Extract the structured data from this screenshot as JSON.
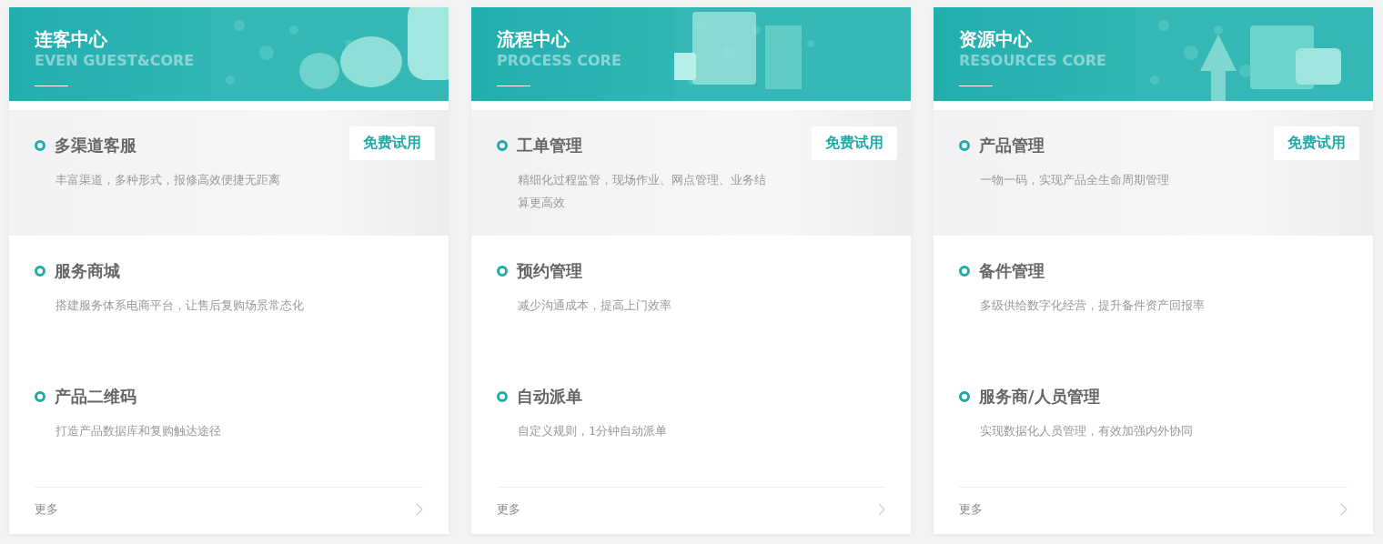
{
  "cards": [
    {
      "title": "连客中心",
      "subtitle": "EVEN GUEST&CORE",
      "items": [
        {
          "name": "多渠道客服",
          "desc": "丰富渠道，多种形式，报修高效便捷无距离",
          "highlighted": true,
          "trial_button": "免费试用"
        },
        {
          "name": "服务商城",
          "desc": "搭建服务体系电商平台，让售后复购场景常态化",
          "highlighted": false
        },
        {
          "name": "产品二维码",
          "desc": "打造产品数据库和复购触达途径",
          "highlighted": false
        }
      ],
      "more": "更多"
    },
    {
      "title": "流程中心",
      "subtitle": "PROCESS CORE",
      "items": [
        {
          "name": "工单管理",
          "desc": "精细化过程监管，现场作业、网点管理、业务结算更高效",
          "highlighted": true,
          "trial_button": "免费试用"
        },
        {
          "name": "预约管理",
          "desc": "减少沟通成本，提高上门效率",
          "highlighted": false
        },
        {
          "name": "自动派单",
          "desc": "自定义规则，1分钟自动派单",
          "highlighted": false
        }
      ],
      "more": "更多"
    },
    {
      "title": "资源中心",
      "subtitle": "RESOURCES CORE",
      "items": [
        {
          "name": "产品管理",
          "desc": "一物一码，实现产品全生命周期管理",
          "highlighted": true,
          "trial_button": "免费试用"
        },
        {
          "name": "备件管理",
          "desc": "多级供给数字化经营，提升备件资产回报率",
          "highlighted": false
        },
        {
          "name": "服务商/人员管理",
          "desc": "实现数据化人员管理，有效加强内外协同",
          "highlighted": false
        }
      ],
      "more": "更多"
    }
  ]
}
